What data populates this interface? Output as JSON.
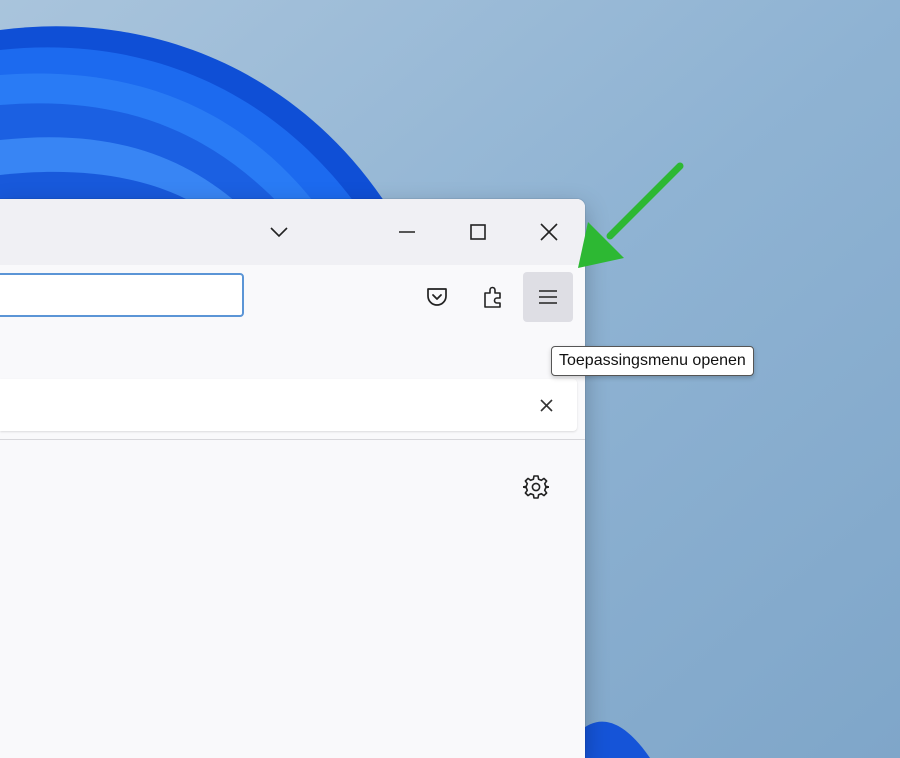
{
  "colors": {
    "arrow": "#2db833",
    "desktop_bg": "#8fb3d3",
    "wallpaper_swirl": "#1a63e8",
    "titlebar": "#f0f0f4",
    "urlbar_focus": "#5b95d6"
  },
  "window": {
    "titlebar": {
      "tabs_list_icon": "chevron-down-icon",
      "minimize_icon": "minimize-icon",
      "maximize_icon": "maximize-icon",
      "close_icon": "close-icon"
    },
    "navbar": {
      "url_value": "",
      "icons": [
        "pocket-icon",
        "extensions-puzzle-icon",
        "hamburger-menu-icon"
      ]
    },
    "notification": {
      "close_icon": "close-icon"
    },
    "content": {
      "settings_icon": "gear-icon"
    }
  },
  "tooltip": {
    "text": "Toepassingsmenu openen"
  }
}
